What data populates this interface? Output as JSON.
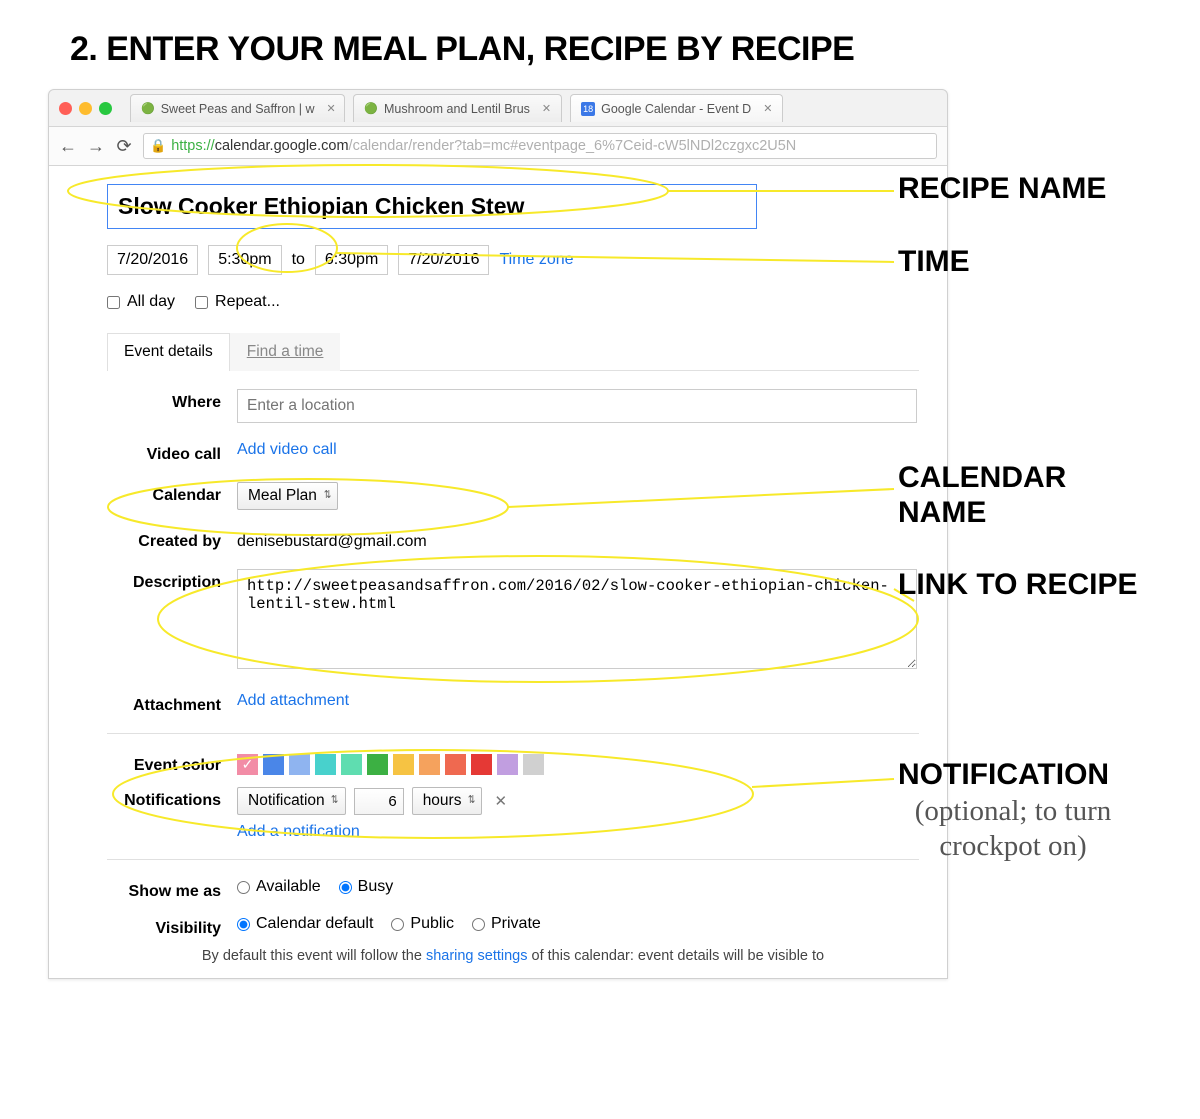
{
  "heading": "2. ENTER YOUR MEAL PLAN, RECIPE BY RECIPE",
  "tabs": [
    {
      "title": "Sweet Peas and Saffron | w"
    },
    {
      "title": "Mushroom and Lentil Brus"
    },
    {
      "title": "Google Calendar - Event D"
    }
  ],
  "url": {
    "proto": "https://",
    "host": "calendar.google.com",
    "path": "/calendar/render?tab=mc#eventpage_6%7Ceid-cW5lNDl2czgxc2U5N"
  },
  "event": {
    "title": "Slow Cooker Ethiopian Chicken Stew",
    "start_date": "7/20/2016",
    "start_time": "5:30pm",
    "to": "to",
    "end_time": "6:30pm",
    "end_date": "7/20/2016",
    "timezone_link": "Time zone",
    "allday": "All day",
    "repeat": "Repeat...",
    "tabs": {
      "details": "Event details",
      "findtime": "Find a time"
    },
    "where_label": "Where",
    "where_placeholder": "Enter a location",
    "videocall_label": "Video call",
    "videocall_link": "Add video call",
    "calendar_label": "Calendar",
    "calendar_value": "Meal Plan",
    "createdby_label": "Created by",
    "createdby_value": "denisebustard@gmail.com",
    "description_label": "Description",
    "description_value": "http://sweetpeasandsaffron.com/2016/02/slow-cooker-ethiopian-chicken-lentil-stew.html",
    "attachment_label": "Attachment",
    "attachment_link": "Add attachment",
    "eventcolor_label": "Event color",
    "colors": [
      "#f28ca6",
      "#4a86e8",
      "#8fb4f0",
      "#48d1cc",
      "#5fddb0",
      "#3cb043",
      "#f6c343",
      "#f5a25d",
      "#ef6950",
      "#e53935",
      "#c19ee0",
      "#d0d0d0"
    ],
    "color_selected_index": 0,
    "notifications_label": "Notifications",
    "notif_type": "Notification",
    "notif_value": "6",
    "notif_unit": "hours",
    "add_notif": "Add a notification",
    "showme_label": "Show me as",
    "showme_options": [
      "Available",
      "Busy"
    ],
    "visibility_label": "Visibility",
    "visibility_options": [
      "Calendar default",
      "Public",
      "Private"
    ],
    "vismsg_pre": "By default this event will follow the ",
    "vismsg_link": "sharing settings",
    "vismsg_post": " of this calendar: event details will be visible to"
  },
  "annotations": {
    "recipe": "RECIPE NAME",
    "time": "TIME",
    "calendarname": "CALENDAR NAME",
    "linktorecipe": "LINK TO RECIPE",
    "notification": "NOTIFICATION",
    "notification_sub": "(optional; to turn crockpot on)"
  }
}
